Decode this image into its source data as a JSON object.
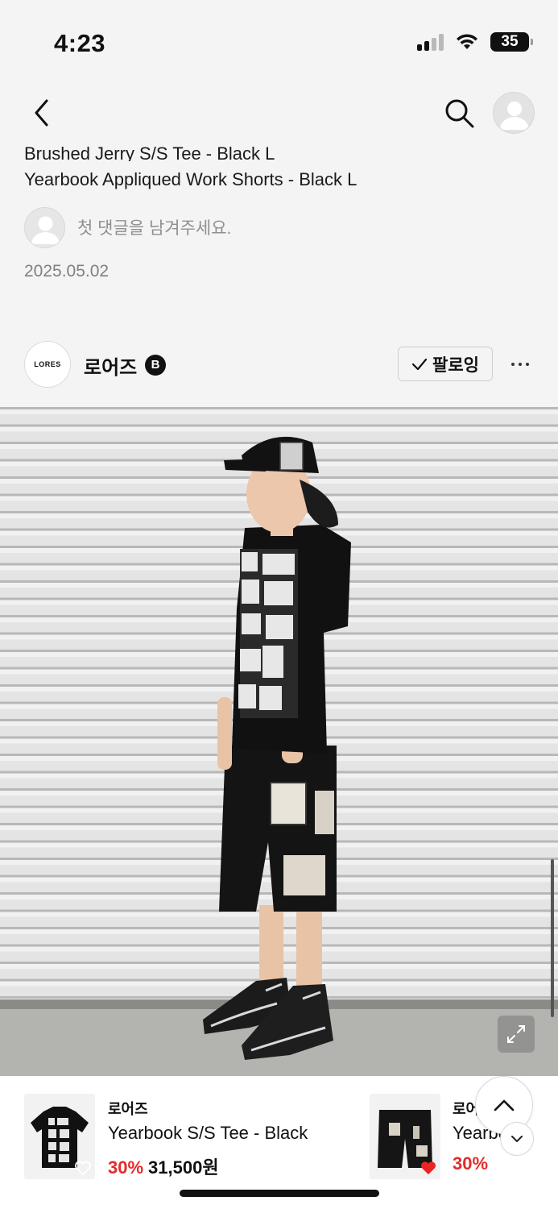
{
  "status_bar": {
    "time": "4:23",
    "battery": "35"
  },
  "post": {
    "product_line_1": "Brushed Jerry S/S Tee - Black L",
    "product_line_2": "Yearbook Appliqued Work Shorts - Black L",
    "comment_placeholder": "첫 댓글을 남겨주세요.",
    "date": "2025.05.02"
  },
  "brand": {
    "logo_text": "LORES",
    "name": "로어즈",
    "badge": "B",
    "follow_label": "팔로잉"
  },
  "products": [
    {
      "brand": "로어즈",
      "name": "Yearbook S/S Tee - Black",
      "discount": "30%",
      "price": "31,500원",
      "liked": false
    },
    {
      "brand": "로어즈",
      "name": "Yearbook Appliqued Work Shorts - Black",
      "discount": "30%",
      "price": "",
      "liked": true
    }
  ],
  "colors": {
    "accent_red": "#e32b2b",
    "background": "#f4f4f4"
  },
  "icons": [
    "back-icon",
    "search-icon",
    "avatar-icon",
    "check-icon",
    "more-icon",
    "expand-icon",
    "heart-icon",
    "chevron-up-icon",
    "chevron-down-icon"
  ]
}
